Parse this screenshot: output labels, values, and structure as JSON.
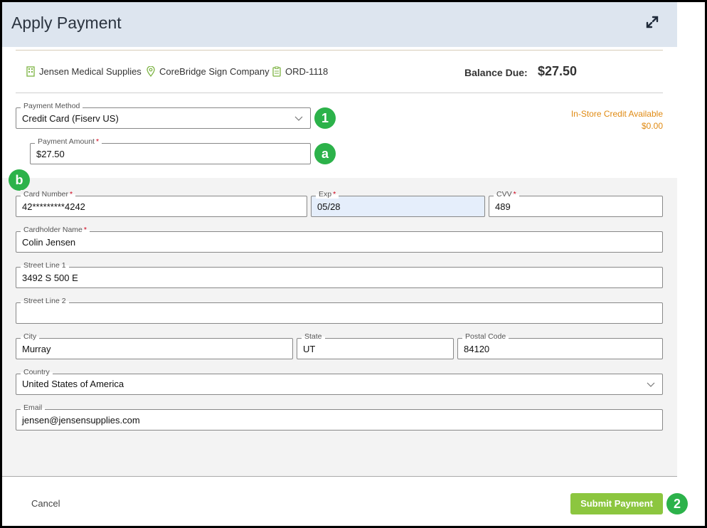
{
  "dialog": {
    "title": "Apply Payment"
  },
  "info": {
    "company": "Jensen Medical Supplies",
    "location": "CoreBridge Sign Company",
    "order": "ORD-1118",
    "balance_label": "Balance Due:",
    "balance_value": "$27.50"
  },
  "credit": {
    "label": "In-Store Credit Available",
    "value": "$0.00"
  },
  "payment_method": {
    "label": "Payment Method",
    "value": "Credit Card (Fiserv US)"
  },
  "payment_amount": {
    "label": "Payment Amount",
    "required": "*",
    "value": "$27.50"
  },
  "card": {
    "number_label": "Card Number",
    "number_value": "42*********4242",
    "exp_label": "Exp",
    "exp_value": "05/28",
    "cvv_label": "CVV",
    "cvv_value": "489",
    "holder_label": "Cardholder Name",
    "holder_value": "Colin Jensen",
    "street1_label": "Street Line 1",
    "street1_value": "3492 S 500 E",
    "street2_label": "Street Line 2",
    "street2_value": "",
    "city_label": "City",
    "city_value": "Murray",
    "state_label": "State",
    "state_value": "UT",
    "postal_label": "Postal Code",
    "postal_value": "84120",
    "country_label": "Country",
    "country_value": "United States of America",
    "email_label": "Email",
    "email_value": "jensen@jensensupplies.com",
    "required_mark": "*"
  },
  "badges": {
    "b1": "1",
    "ba": "a",
    "bb": "b",
    "b2": "2"
  },
  "footer": {
    "cancel": "Cancel",
    "submit": "Submit Payment"
  },
  "colors": {
    "header_bg": "#dde5ef",
    "badge": "#2cb24a",
    "submit": "#8cc63f",
    "credit": "#e08a12"
  }
}
